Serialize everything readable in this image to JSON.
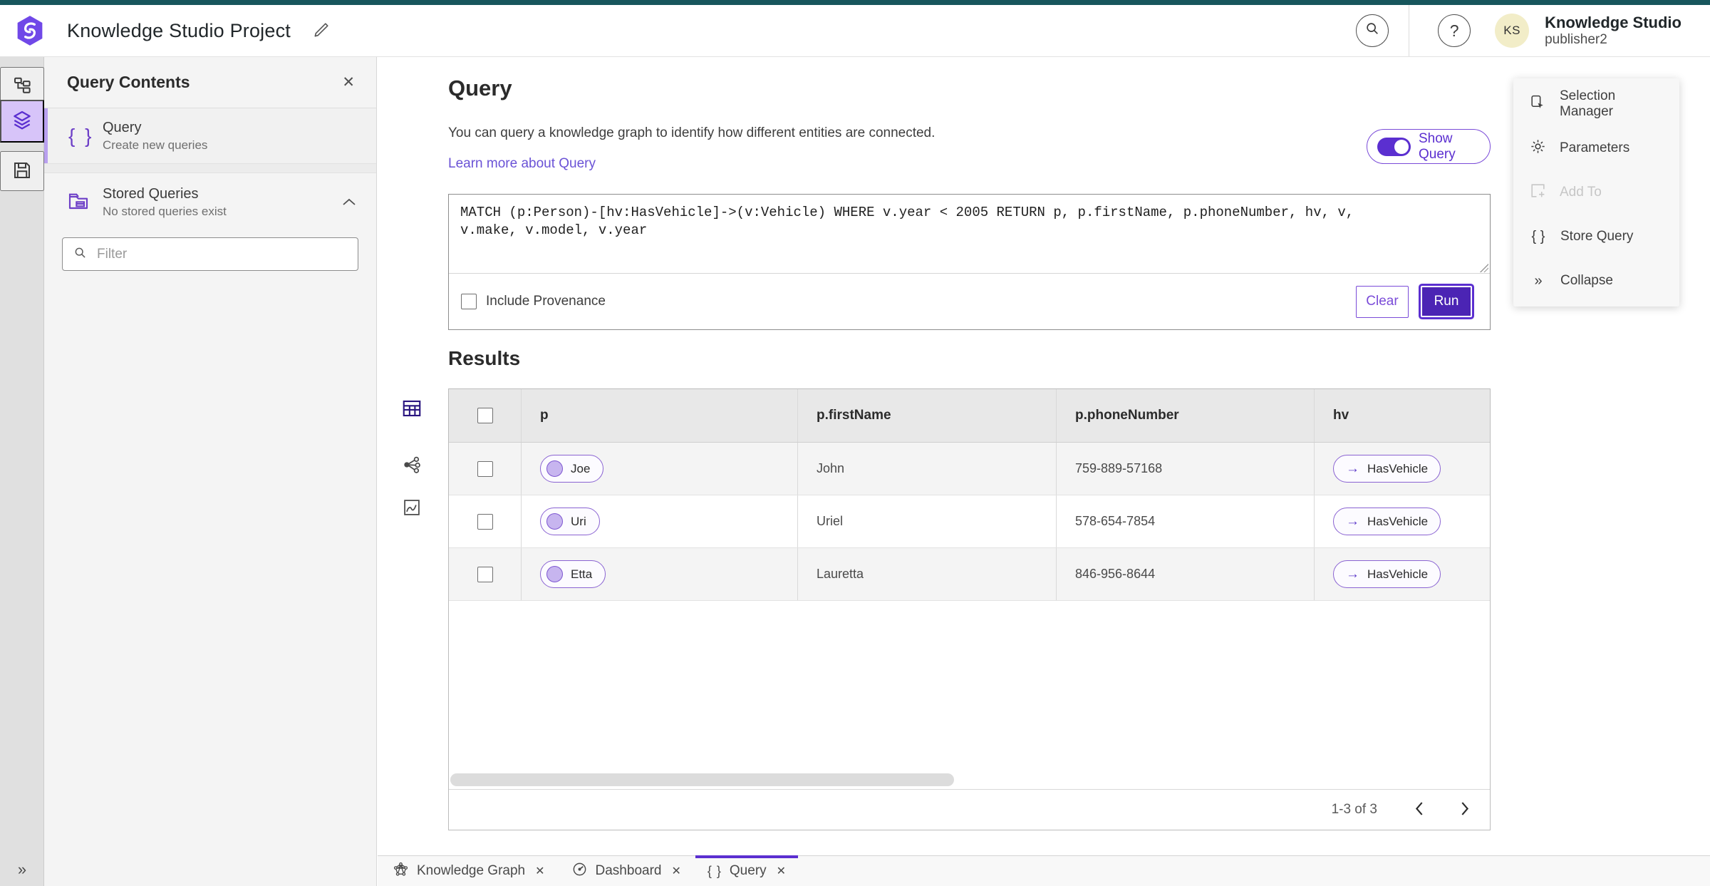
{
  "header": {
    "title": "Knowledge Studio Project",
    "user_name": "Knowledge Studio",
    "user_role": "publisher2",
    "avatar_initials": "KS",
    "help_glyph": "?"
  },
  "panel": {
    "title": "Query Contents",
    "query_item": {
      "label": "Query",
      "description": "Create new queries"
    },
    "stored_item": {
      "label": "Stored Queries",
      "description": "No stored queries exist"
    },
    "filter_placeholder": "Filter"
  },
  "query": {
    "heading": "Query",
    "description": "You can query a knowledge graph to identify how different entities are connected.",
    "learn_more": "Learn more about Query",
    "show_query_label": "Show Query",
    "query_text": "MATCH (p:Person)-[hv:HasVehicle]->(v:Vehicle) WHERE v.year < 2005 RETURN p, p.firstName, p.phoneNumber, hv, v, v.make, v.model, v.year",
    "include_provenance_label": "Include Provenance",
    "clear_label": "Clear",
    "run_label": "Run"
  },
  "results": {
    "heading": "Results",
    "columns": [
      "p",
      "p.firstName",
      "p.phoneNumber",
      "hv"
    ],
    "rows": [
      {
        "p": "Joe",
        "firstName": "John",
        "phoneNumber": "759-889-57168",
        "hv": "HasVehicle"
      },
      {
        "p": "Uri",
        "firstName": "Uriel",
        "phoneNumber": "578-654-7854",
        "hv": "HasVehicle"
      },
      {
        "p": "Etta",
        "firstName": "Lauretta",
        "phoneNumber": "846-956-8644",
        "hv": "HasVehicle"
      }
    ],
    "pagination": "1-3 of 3"
  },
  "side_menu": {
    "items": [
      {
        "label": "Selection Manager"
      },
      {
        "label": "Parameters"
      },
      {
        "label": "Add To"
      },
      {
        "label": "Store Query"
      },
      {
        "label": "Collapse"
      }
    ]
  },
  "tabs": [
    {
      "label": "Knowledge Graph"
    },
    {
      "label": "Dashboard"
    },
    {
      "label": "Query"
    }
  ],
  "icons": {
    "close": "✕",
    "braces": "{ }",
    "collapse": "»",
    "edge_arrow": "→"
  },
  "colors": {
    "accent_purple": "#5b2fd0",
    "run_fill": "#4b24b4",
    "active_highlight": "#d7c4f9",
    "top_strip_teal": "#17565c",
    "link_purple": "#6a52d6",
    "avatar_yellow": "#f2edc8"
  }
}
